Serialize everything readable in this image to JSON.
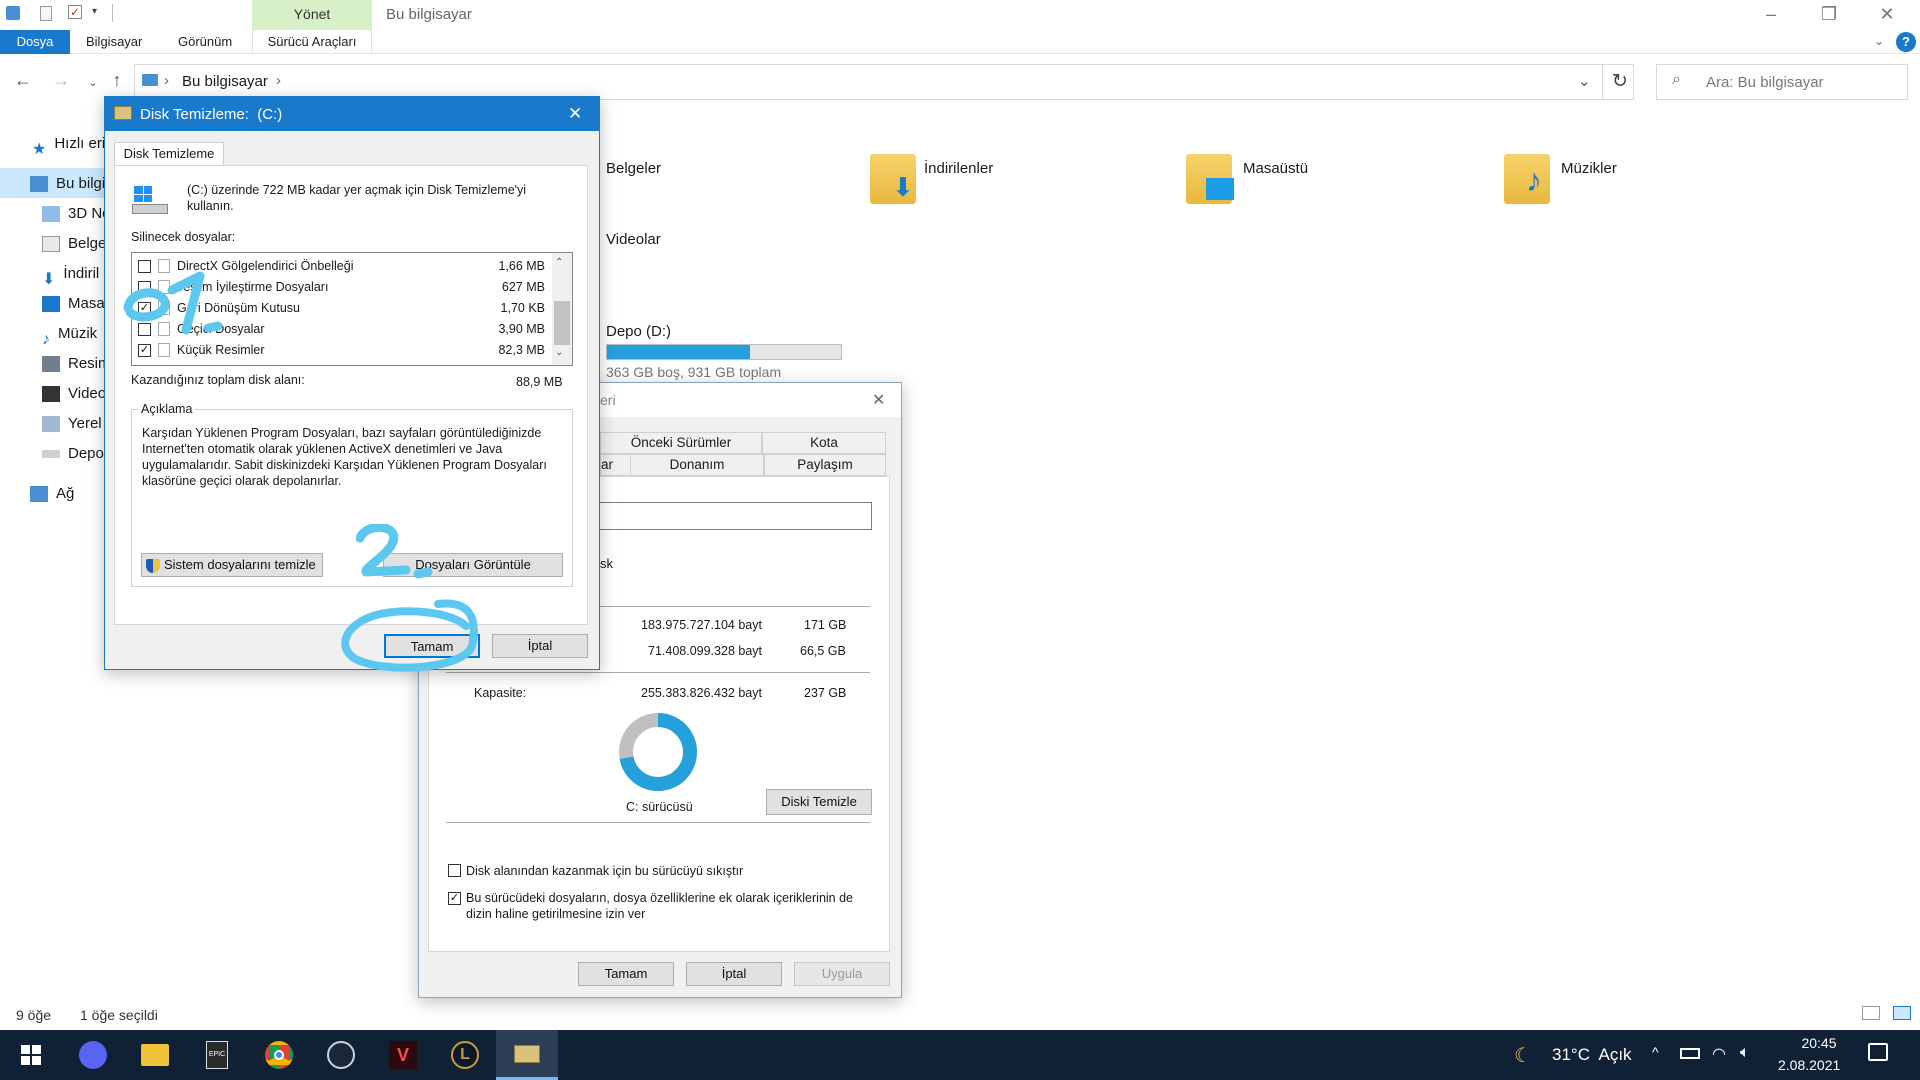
{
  "window": {
    "manage_tab": "Yönet",
    "title": "Bu bilgisayar",
    "ribbon_tabs": [
      "Dosya",
      "Bilgisayar",
      "Görünüm",
      "Sürücü Araçları"
    ]
  },
  "address": {
    "path": "Bu bilgisayar",
    "search_placeholder": "Ara: Bu bilgisayar"
  },
  "nav": {
    "items": [
      "Hızlı eri",
      "Bu bilgi",
      "3D Ne",
      "Belge",
      "İndiril",
      "Masaü",
      "Müzik",
      "Resim",
      "Video",
      "Yerel I",
      "Depo",
      "Ağ"
    ]
  },
  "folders": {
    "items": [
      "Belgeler",
      "İndirilenler",
      "Masaüstü",
      "Müzikler",
      "Videolar"
    ]
  },
  "drive_d": {
    "label": "Depo (D:)",
    "space": "363 GB boş, 931 GB toplam",
    "used_fraction": 0.61
  },
  "cleanup_dialog": {
    "title": "Disk Temizleme:  (C:)",
    "tab": "Disk Temizleme",
    "intro": "(C:) üzerinde 722 MB kadar yer açmak için Disk Temizleme'yi kullanın.",
    "files_label": "Silinecek dosyalar:",
    "files": [
      {
        "name": "DirectX Gölgelendirici Önbelleği",
        "size": "1,66 MB",
        "checked": false
      },
      {
        "name": "Teslim İyileştirme Dosyaları",
        "size": "627 MB",
        "checked": false
      },
      {
        "name": "Geri Dönüşüm Kutusu",
        "size": "1,70 KB",
        "checked": true
      },
      {
        "name": "Geçici Dosyalar",
        "size": "3,90 MB",
        "checked": false
      },
      {
        "name": "Küçük Resimler",
        "size": "82,3 MB",
        "checked": true
      }
    ],
    "total_label": "Kazandığınız toplam disk alanı:",
    "total_value": "88,9 MB",
    "description_label": "Açıklama",
    "description": "Karşıdan Yüklenen Program Dosyaları, bazı sayfaları görüntülediğinizde Internet'ten otomatik olarak yüklenen ActiveX denetimleri ve Java uygulamalarıdır. Sabit diskinizdeki Karşıdan Yüklenen Program Dosyaları klasörüne geçici olarak depolanırlar.",
    "clean_system_btn": "Sistem dosyalarını temizle",
    "view_files_btn": "Dosyaları Görüntüle",
    "ok_btn": "Tamam",
    "cancel_btn": "İptal"
  },
  "props_dialog": {
    "title_fragment": "eri",
    "tabs_row1": [
      "Önceki Sürümler",
      "Kota"
    ],
    "tabs_row2": [
      "ar",
      "Donanım",
      "Paylaşım"
    ],
    "type_fragment": "sk",
    "used_bytes": "183.975.727.104 bayt",
    "used_gb": "171 GB",
    "free_bytes": "71.408.099.328 bayt",
    "free_gb": "66,5 GB",
    "capacity_label": "Kapasite:",
    "capacity_bytes": "255.383.826.432 bayt",
    "capacity_gb": "237 GB",
    "used_fraction": 0.72,
    "drive_label": "C: sürücüsü",
    "disk_cleanup_btn": "Diski Temizle",
    "compress_label": "Disk alanından kazanmak için bu sürücüyü sıkıştır",
    "compress_checked": false,
    "index_label": "Bu sürücüdeki dosyaların, dosya özelliklerine ek olarak içeriklerinin de dizin haline getirilmesine izin ver",
    "index_checked": true,
    "ok_btn": "Tamam",
    "cancel_btn": "İptal",
    "apply_btn": "Uygula"
  },
  "status": {
    "items": "9 öğe",
    "selected": "1 öğe seçildi"
  },
  "taskbar": {
    "weather": "31°C  Açık",
    "time": "20:45",
    "date": "2.08.2021"
  },
  "annotations": {
    "step1": "1.",
    "step2": "2."
  },
  "colors": {
    "accent": "#1979ca",
    "taskbar": "#102035",
    "annotation": "#5cc8f0"
  }
}
